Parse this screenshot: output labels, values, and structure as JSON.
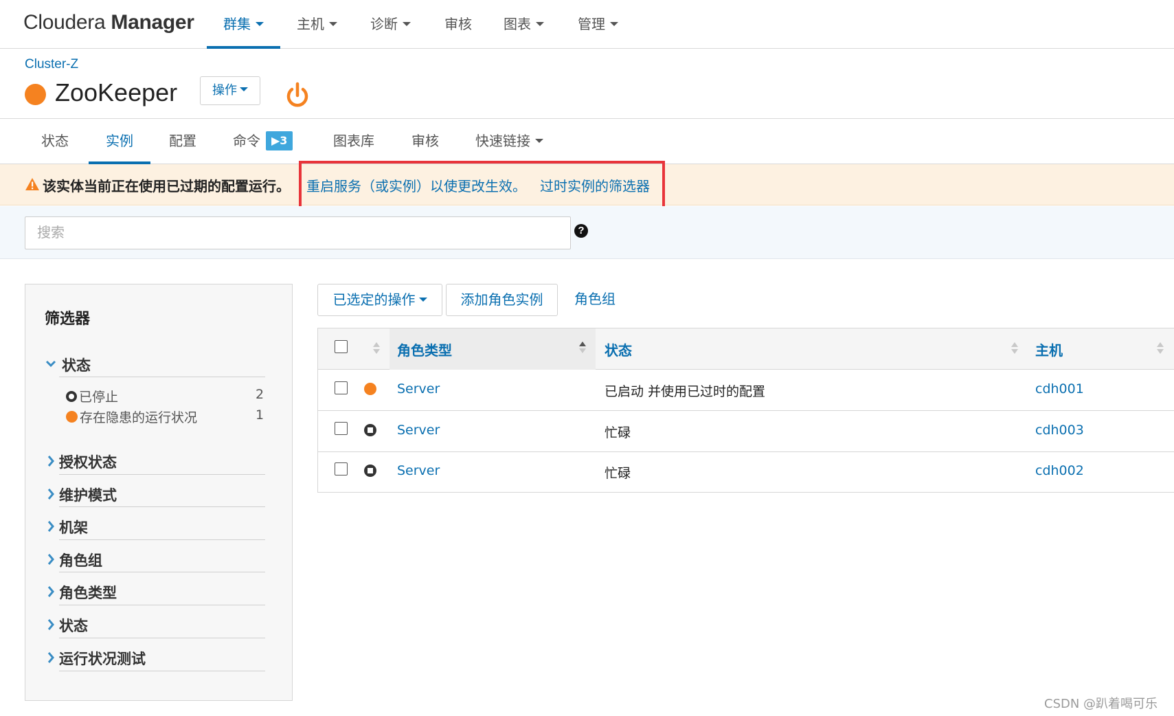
{
  "brand": {
    "part1": "Cloudera ",
    "part2": "Manager"
  },
  "nav": {
    "items": [
      {
        "label": "群集",
        "dropdown": true,
        "active": true
      },
      {
        "label": "主机",
        "dropdown": true
      },
      {
        "label": "诊断",
        "dropdown": true
      },
      {
        "label": "审核",
        "dropdown": false
      },
      {
        "label": "图表",
        "dropdown": true
      },
      {
        "label": "管理",
        "dropdown": true
      }
    ]
  },
  "header": {
    "breadcrumb": "Cluster-Z",
    "service_name": "ZooKeeper",
    "service_status_color": "#f58220",
    "actions_label": "操作",
    "power_icon": "power-icon"
  },
  "tabs": {
    "items": [
      {
        "label": "状态"
      },
      {
        "label": "实例",
        "active": true
      },
      {
        "label": "配置"
      },
      {
        "label": "命令",
        "badge": "▶3"
      },
      {
        "label": "图表库"
      },
      {
        "label": "审核"
      },
      {
        "label": "快速链接",
        "dropdown": true
      }
    ]
  },
  "warning": {
    "text": "该实体当前正在使用已过期的配置运行。",
    "link1": "重启服务（或实例）以使更改生效。",
    "link2": "过时实例的筛选器"
  },
  "search": {
    "placeholder": "搜索",
    "value": ""
  },
  "filters": {
    "title": "筛选器",
    "sections": [
      {
        "label": "状态",
        "expanded": true,
        "options": [
          {
            "icon": "stopped-icon",
            "label": "已停止",
            "count": "2"
          },
          {
            "icon": "warning-status-dot",
            "label": "存在隐患的运行状况",
            "count": "1"
          }
        ]
      },
      {
        "label": "授权状态",
        "expanded": false
      },
      {
        "label": "维护模式",
        "expanded": false
      },
      {
        "label": "机架",
        "expanded": false
      },
      {
        "label": "角色组",
        "expanded": false
      },
      {
        "label": "角色类型",
        "expanded": false
      },
      {
        "label": "状态",
        "expanded": false
      },
      {
        "label": "运行状况测试",
        "expanded": false
      }
    ]
  },
  "toolbar": {
    "selected_actions": "已选定的操作",
    "add_role_instance": "添加角色实例",
    "role_groups": "角色组"
  },
  "table": {
    "columns": [
      "角色类型",
      "状态",
      "主机"
    ],
    "rows": [
      {
        "status_icon": "orange-dot",
        "role_type": "Server",
        "state": "已启动 并使用已过时的配置",
        "host": "cdh001"
      },
      {
        "status_icon": "stopped-icon",
        "role_type": "Server",
        "state": "忙碌",
        "host": "cdh003"
      },
      {
        "status_icon": "stopped-icon",
        "role_type": "Server",
        "state": "忙碌",
        "host": "cdh002"
      }
    ]
  },
  "watermark": "CSDN @趴着喝可乐",
  "colors": {
    "accent": "#0a6fb0",
    "warning": "#f58220",
    "highlight": "#e8343a",
    "warning_bg": "#fdf1e1"
  }
}
